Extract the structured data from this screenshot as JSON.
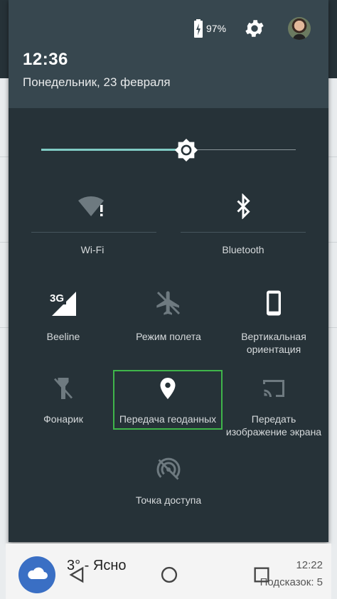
{
  "status": {
    "battery_percent": "97%"
  },
  "header": {
    "time": "12:36",
    "date": "Понедельник, 23 февраля"
  },
  "brightness": {
    "level": 0.57
  },
  "tiles": {
    "wifi": "Wi-Fi",
    "bluetooth": "Bluetooth",
    "mobile": "Beeline",
    "airplane": "Режим полета",
    "rotation_line1": "Вертикальная",
    "rotation_line2": "ориентация",
    "flashlight": "Фонарик",
    "location": "Передача геоданных",
    "cast_line1": "Передать",
    "cast_line2": "изображение экрана",
    "hotspot": "Точка доступа",
    "mobile_badge": "3G"
  },
  "card": {
    "weather": "3° - Ясно",
    "time": "12:22",
    "hints": "Подсказок: 5"
  },
  "colors": {
    "accent": "#80cbc4",
    "highlight": "#3fb54a",
    "shade": "#263238",
    "header": "#37474f"
  },
  "icons": [
    "battery-icon",
    "gear-icon",
    "avatar",
    "brightness-icon",
    "wifi-icon",
    "bluetooth-icon",
    "signal-icon",
    "airplane-icon",
    "phone-rotation-icon",
    "flashlight-icon",
    "location-pin-icon",
    "cast-icon",
    "hotspot-icon",
    "cloud-icon",
    "back-icon",
    "home-icon",
    "recents-icon"
  ]
}
